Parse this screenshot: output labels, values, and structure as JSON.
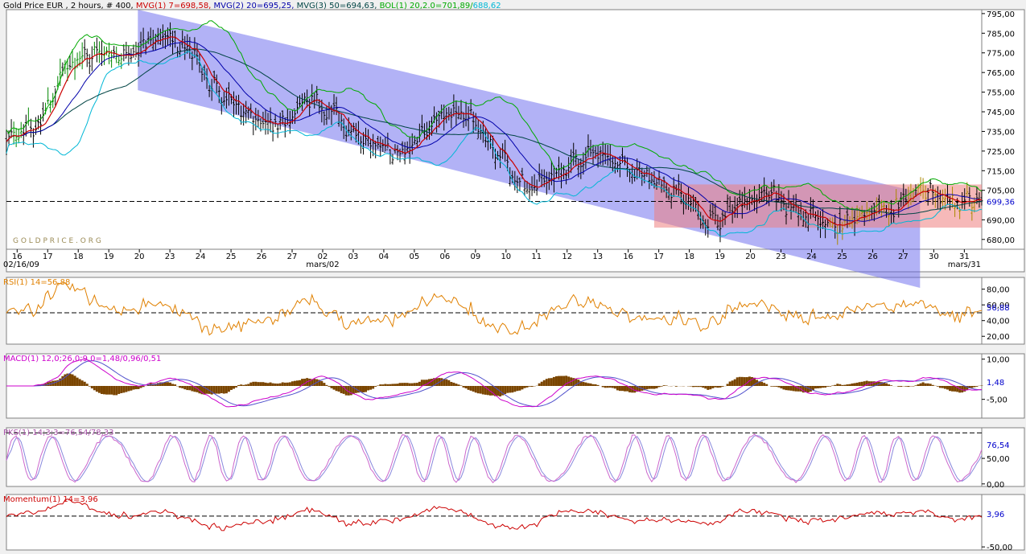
{
  "header": {
    "instrument": "Gold Price EUR , 2 hours, # 400, ",
    "mvg1": "MVG(1) 7=698,58, ",
    "mvg2": "MVG(2) 20=695,25, ",
    "mvg3": "MVG(3) 50=694,63, ",
    "bol_a": "BOL(1) 20,2.0=701,89/",
    "bol_b": "688,62"
  },
  "watermark": "G O L D P R I C E . O R G",
  "date_caption": "02/16/09",
  "colors": {
    "price_bar": "#000000",
    "mvg1": "#cc0000",
    "mvg2": "#0000aa",
    "mvg3": "#004444",
    "bol_upper": "#00aa00",
    "bol_lower": "#00b7d6",
    "channel": "#6666ee",
    "range_box": "#ee8080",
    "rsi": "#e08000",
    "macd_line": "#cc00cc",
    "macd_signal": "#5050cc",
    "macd_hist": "#7a4500",
    "pks_k": "#cc66cc",
    "pks_d": "#8888dd",
    "momentum": "#cc0000"
  },
  "chart_data": [
    {
      "type": "line",
      "panel": "price",
      "title": "Gold Price EUR , 2 hours, # 400",
      "y_ticks": [
        "795,00",
        "785,00",
        "775,00",
        "765,00",
        "755,00",
        "745,00",
        "735,00",
        "725,00",
        "715,00",
        "705,00",
        "690,00",
        "680,00"
      ],
      "ylim": [
        675,
        797
      ],
      "x_ticks": [
        "16",
        "17",
        "18",
        "19",
        "20",
        "23",
        "24",
        "25",
        "26",
        "27",
        "02",
        "03",
        "04",
        "05",
        "06",
        "09",
        "10",
        "11",
        "12",
        "13",
        "16",
        "17",
        "18",
        "19",
        "20",
        "23",
        "24",
        "25",
        "26",
        "27",
        "30",
        "31"
      ],
      "x_sublabels": [
        "mars/02",
        "mars/31"
      ],
      "last_value_label": "699,36",
      "reference_line": 699.36,
      "annotations": [
        "declining channel 20 → 27",
        "range box 17 → 31, 686–708"
      ],
      "series": [
        {
          "name": "MVG(1) 7",
          "last": "698,58"
        },
        {
          "name": "MVG(2) 20",
          "last": "695,25"
        },
        {
          "name": "MVG(3) 50",
          "last": "694,63"
        },
        {
          "name": "BOL(1) 20,2.0",
          "upper": "701,89",
          "lower": "688,62"
        }
      ],
      "key_points": {
        "dates": [
          "16",
          "17",
          "18",
          "19",
          "20",
          "23",
          "24",
          "25",
          "26",
          "27",
          "02",
          "03",
          "04",
          "05",
          "06",
          "09",
          "10",
          "11",
          "12",
          "13",
          "16",
          "17",
          "18",
          "19",
          "20",
          "23",
          "24",
          "25",
          "26",
          "27",
          "30",
          "31"
        ],
        "close": [
          731,
          737,
          769,
          776,
          772,
          784,
          778,
          752,
          742,
          738,
          752,
          740,
          727,
          723,
          742,
          744,
          726,
          705,
          713,
          724,
          719,
          713,
          704,
          688,
          699,
          704,
          693,
          687,
          692,
          696,
          706,
          699
        ]
      }
    },
    {
      "type": "line",
      "panel": "rsi",
      "title": "RSI(1) 14=56,88",
      "y_ticks": [
        "80,00",
        "60,00",
        "40,00",
        "20,00"
      ],
      "ylim": [
        10,
        95
      ],
      "last_value_label": "56,88",
      "reference_line": 50
    },
    {
      "type": "bar",
      "panel": "macd",
      "title": "MACD(1) 12,0;26,0;9,0=1,48/0,96/0,51",
      "y_ticks": [
        "10,00",
        "-5,00"
      ],
      "ylim": [
        -12,
        12
      ],
      "last_value_label": "1,48",
      "series": [
        {
          "name": "MACD",
          "last": "1,48"
        },
        {
          "name": "Signal",
          "last": "0,96"
        },
        {
          "name": "Histogram",
          "last": "0,51"
        }
      ]
    },
    {
      "type": "line",
      "panel": "pks",
      "title": "PKS(1) 14;3;3=76,54/78,33",
      "y_ticks": [
        "50,00",
        "0,00"
      ],
      "ylim": [
        -5,
        110
      ],
      "last_value_label": "76,54",
      "reference_line": 100,
      "series": [
        {
          "name": "%K",
          "last": "76,54"
        },
        {
          "name": "%D",
          "last": "78,33"
        }
      ]
    },
    {
      "type": "line",
      "panel": "momentum",
      "title": "Momentum(1) 14=3,96",
      "y_ticks": [
        "-50,00"
      ],
      "ylim": [
        -55,
        35
      ],
      "last_value_label": "3,96",
      "reference_line": 0
    }
  ]
}
